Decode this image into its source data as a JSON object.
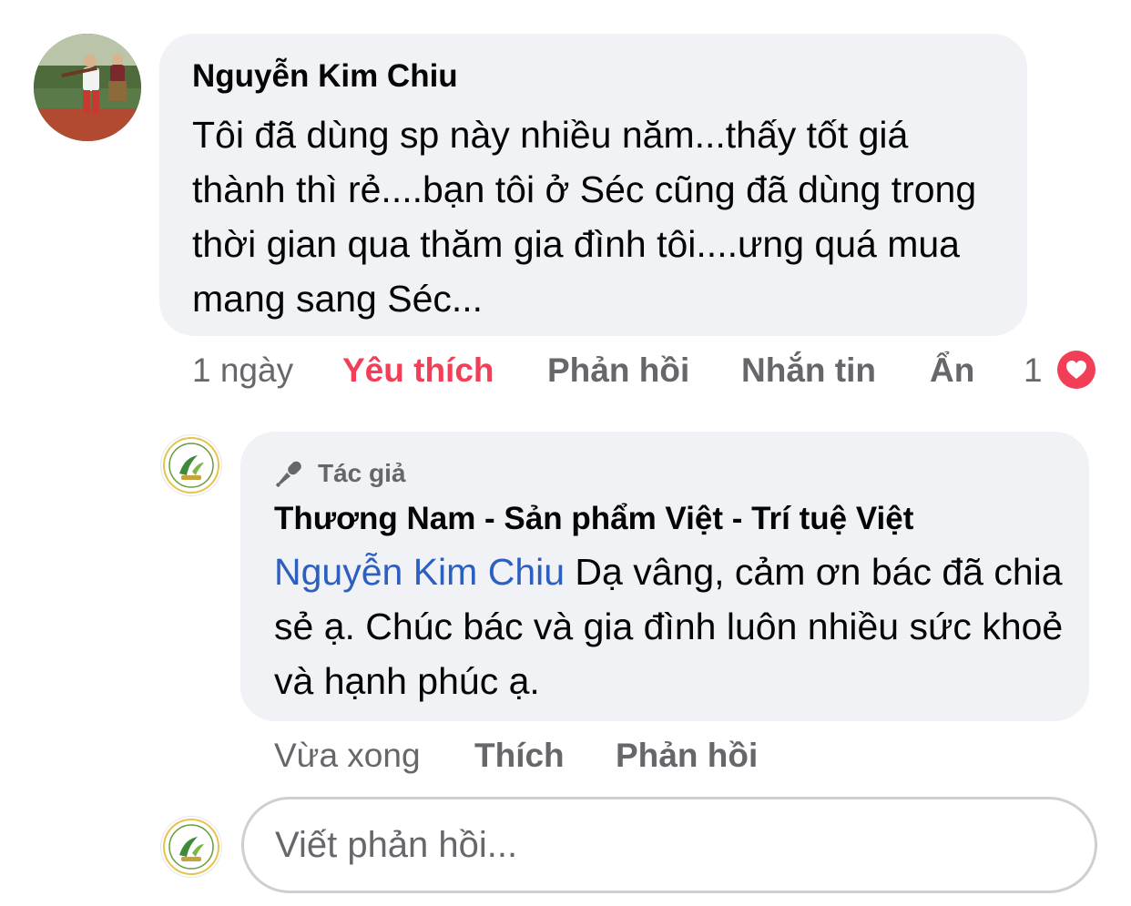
{
  "comment": {
    "author": "Nguyễn Kim Chiu",
    "text": "Tôi đã dùng sp này nhiều năm...thấy tốt giá thành thì rẻ....bạn tôi ở Séc cũng đã dùng trong thời gian qua thăm gia đình tôi....ưng quá mua mang sang Séc...",
    "actions": {
      "time": "1 ngày",
      "like": "Yêu thích",
      "reply": "Phản hồi",
      "message": "Nhắn tin",
      "hide": "Ẩn"
    },
    "reaction_count": "1",
    "reaction_icon": "heart-icon",
    "liked": true
  },
  "reply": {
    "badge_icon": "microphone-icon",
    "badge_label": "Tác giả",
    "author": "Thương Nam - Sản phẩm Việt - Trí tuệ Việt",
    "mention": "Nguyễn Kim Chiu",
    "text": " Dạ vâng, cảm ơn bác đã chia sẻ ạ. Chúc bác và gia đình luôn nhiều sức khoẻ và hạnh phúc ạ.",
    "actions": {
      "time": "Vừa xong",
      "like": "Thích",
      "reply": "Phản hồi"
    }
  },
  "composer": {
    "placeholder": "Viết phản hồi..."
  },
  "colors": {
    "bubble": "#f0f2f5",
    "secondary_text": "#65676b",
    "liked": "#f33e58",
    "mention": "#2d5fc0"
  }
}
